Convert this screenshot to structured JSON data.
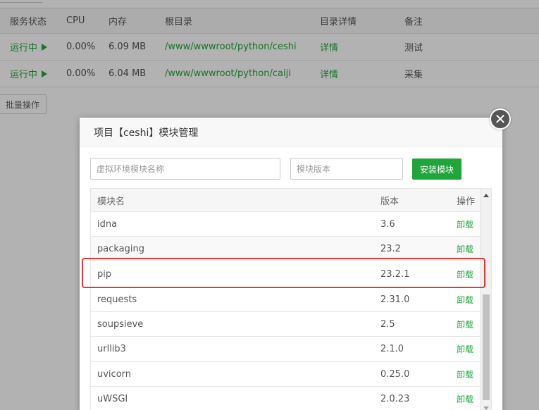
{
  "background": {
    "headers": {
      "status": "服务状态",
      "cpu": "CPU",
      "memory": "内存",
      "root": "根目录",
      "detail": "目录详情",
      "note": "备注"
    },
    "rows": [
      {
        "status": "运行中",
        "cpu": "0.00%",
        "memory": "6.09 MB",
        "root": "/www/wwwroot/python/ceshi",
        "detail": "详情",
        "note": "测试"
      },
      {
        "status": "运行中",
        "cpu": "0.00%",
        "memory": "6.04 MB",
        "root": "/www/wwwroot/python/caiji",
        "detail": "详情",
        "note": "采集"
      }
    ],
    "batch_button": "批量操作"
  },
  "modal": {
    "title": "项目【ceshi】模块管理",
    "close_icon": "close-icon",
    "name_placeholder": "虚拟环境模块名称",
    "version_placeholder": "模块版本",
    "install_button": "安装模块",
    "columns": {
      "name": "模块名",
      "version": "版本",
      "action": "操作"
    },
    "modules": [
      {
        "name": "idna",
        "version": "3.6",
        "action": "卸载"
      },
      {
        "name": "packaging",
        "version": "23.2",
        "action": "卸载"
      },
      {
        "name": "pip",
        "version": "23.2.1",
        "action": "卸载"
      },
      {
        "name": "requests",
        "version": "2.31.0",
        "action": "卸载"
      },
      {
        "name": "soupsieve",
        "version": "2.5",
        "action": "卸载"
      },
      {
        "name": "urllib3",
        "version": "2.1.0",
        "action": "卸载"
      },
      {
        "name": "uvicorn",
        "version": "0.25.0",
        "action": "卸载"
      },
      {
        "name": "uWSGI",
        "version": "2.0.23",
        "action": "卸载"
      }
    ]
  },
  "colors": {
    "accent": "#20a53a",
    "highlight": "#e53935"
  }
}
